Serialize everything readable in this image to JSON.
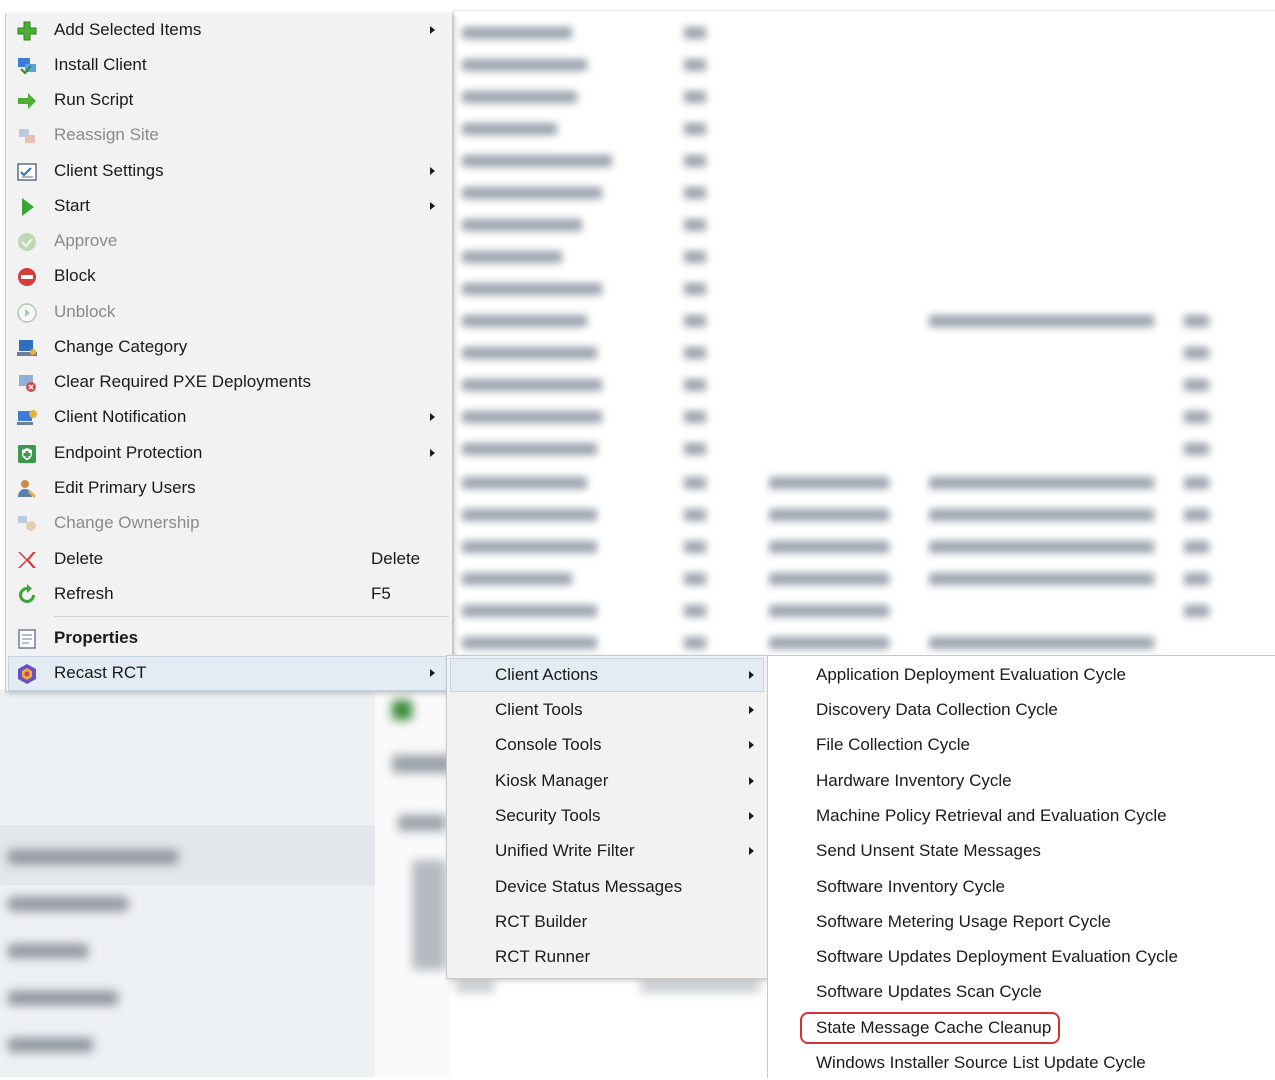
{
  "main_menu": {
    "items": [
      {
        "label": "Add Selected Items",
        "icon": "plus-icon",
        "submenu": true,
        "enabled": true
      },
      {
        "label": "Install Client",
        "icon": "install-client-icon",
        "submenu": false,
        "enabled": true
      },
      {
        "label": "Run Script",
        "icon": "arrow-right-icon",
        "submenu": false,
        "enabled": true
      },
      {
        "label": "Reassign Site",
        "icon": "reassign-site-icon",
        "submenu": false,
        "enabled": false
      },
      {
        "label": "Client Settings",
        "icon": "client-settings-icon",
        "submenu": true,
        "enabled": true
      },
      {
        "label": "Start",
        "icon": "play-icon",
        "submenu": true,
        "enabled": true
      },
      {
        "label": "Approve",
        "icon": "approve-icon",
        "submenu": false,
        "enabled": false
      },
      {
        "label": "Block",
        "icon": "block-icon",
        "submenu": false,
        "enabled": true
      },
      {
        "label": "Unblock",
        "icon": "unblock-icon",
        "submenu": false,
        "enabled": false
      },
      {
        "label": "Change Category",
        "icon": "change-category-icon",
        "submenu": false,
        "enabled": true
      },
      {
        "label": "Clear Required PXE Deployments",
        "icon": "pxe-icon",
        "submenu": false,
        "enabled": true
      },
      {
        "label": "Client Notification",
        "icon": "client-notification-icon",
        "submenu": true,
        "enabled": true
      },
      {
        "label": "Endpoint Protection",
        "icon": "endpoint-protection-icon",
        "submenu": true,
        "enabled": true
      },
      {
        "label": "Edit Primary Users",
        "icon": "primary-users-icon",
        "submenu": false,
        "enabled": true
      },
      {
        "label": "Change Ownership",
        "icon": "change-ownership-icon",
        "submenu": false,
        "enabled": false
      },
      {
        "label": "Delete",
        "icon": "delete-icon",
        "submenu": false,
        "enabled": true,
        "shortcut": "Delete"
      },
      {
        "label": "Refresh",
        "icon": "refresh-icon",
        "submenu": false,
        "enabled": true,
        "shortcut": "F5"
      }
    ],
    "properties": {
      "label": "Properties",
      "icon": "properties-icon"
    },
    "recast": {
      "label": "Recast RCT",
      "icon": "recast-icon",
      "submenu": true
    }
  },
  "recast_submenu": {
    "items": [
      {
        "label": "Client Actions",
        "submenu": true
      },
      {
        "label": "Client Tools",
        "submenu": true
      },
      {
        "label": "Console Tools",
        "submenu": true
      },
      {
        "label": "Kiosk Manager",
        "submenu": true
      },
      {
        "label": "Security Tools",
        "submenu": true
      },
      {
        "label": "Unified Write Filter",
        "submenu": true
      },
      {
        "label": "Device Status Messages",
        "submenu": false
      },
      {
        "label": "RCT Builder",
        "submenu": false
      },
      {
        "label": "RCT Runner",
        "submenu": false
      }
    ]
  },
  "client_actions_menu": {
    "items": [
      {
        "label": "Application Deployment Evaluation Cycle"
      },
      {
        "label": "Discovery Data Collection Cycle"
      },
      {
        "label": "File Collection Cycle"
      },
      {
        "label": "Hardware Inventory Cycle"
      },
      {
        "label": "Machine Policy Retrieval and Evaluation Cycle"
      },
      {
        "label": "Send Unsent State Messages"
      },
      {
        "label": "Software Inventory Cycle"
      },
      {
        "label": "Software Metering Usage Report Cycle"
      },
      {
        "label": "Software Updates Deployment Evaluation Cycle"
      },
      {
        "label": "Software Updates Scan Cycle"
      },
      {
        "label": "State Message Cache Cleanup",
        "circled": true
      },
      {
        "label": "Windows Installer Source List Update Cycle"
      }
    ]
  },
  "colors": {
    "highlight_circle": "#d93131",
    "menu_background": "#f2f2f2",
    "hover": "#e3ebf3"
  }
}
